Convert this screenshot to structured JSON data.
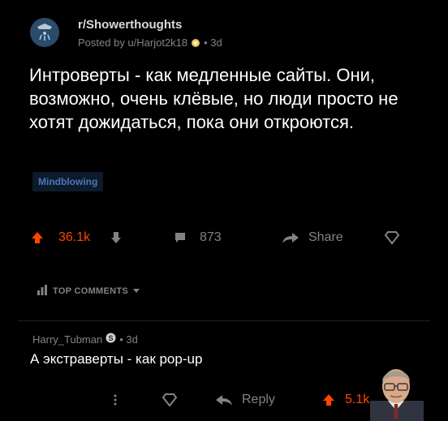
{
  "post": {
    "subreddit": "r/Showerthoughts",
    "posted_by": "Posted by u/Harjot2k18",
    "age": "• 3d",
    "title": "Интроверты - как медленные сайты. Они, возможно, очень клёвые, но люди просто не хотят дожидаться, пока они откроются.",
    "flair": "Mindblowing",
    "score": "36.1k",
    "comments": "873",
    "share_label": "Share"
  },
  "comments_section": {
    "sort_label": "TOP COMMENTS"
  },
  "comment": {
    "author": "Harry_Tubman",
    "age": "• 3d",
    "body": "А экстраверты - как pop-up",
    "reply_label": "Reply",
    "score": "5.1k"
  },
  "colors": {
    "upvote": "#ff4500",
    "muted": "#818384",
    "flair": "#4a78b8"
  },
  "icons": [
    "subreddit-icon",
    "award-icon",
    "upvote-icon",
    "downvote-icon",
    "comment-icon",
    "share-icon",
    "save-icon",
    "sort-icon",
    "chevron-down-icon",
    "gold-icon",
    "more-icon",
    "reply-icon",
    "avatar"
  ]
}
